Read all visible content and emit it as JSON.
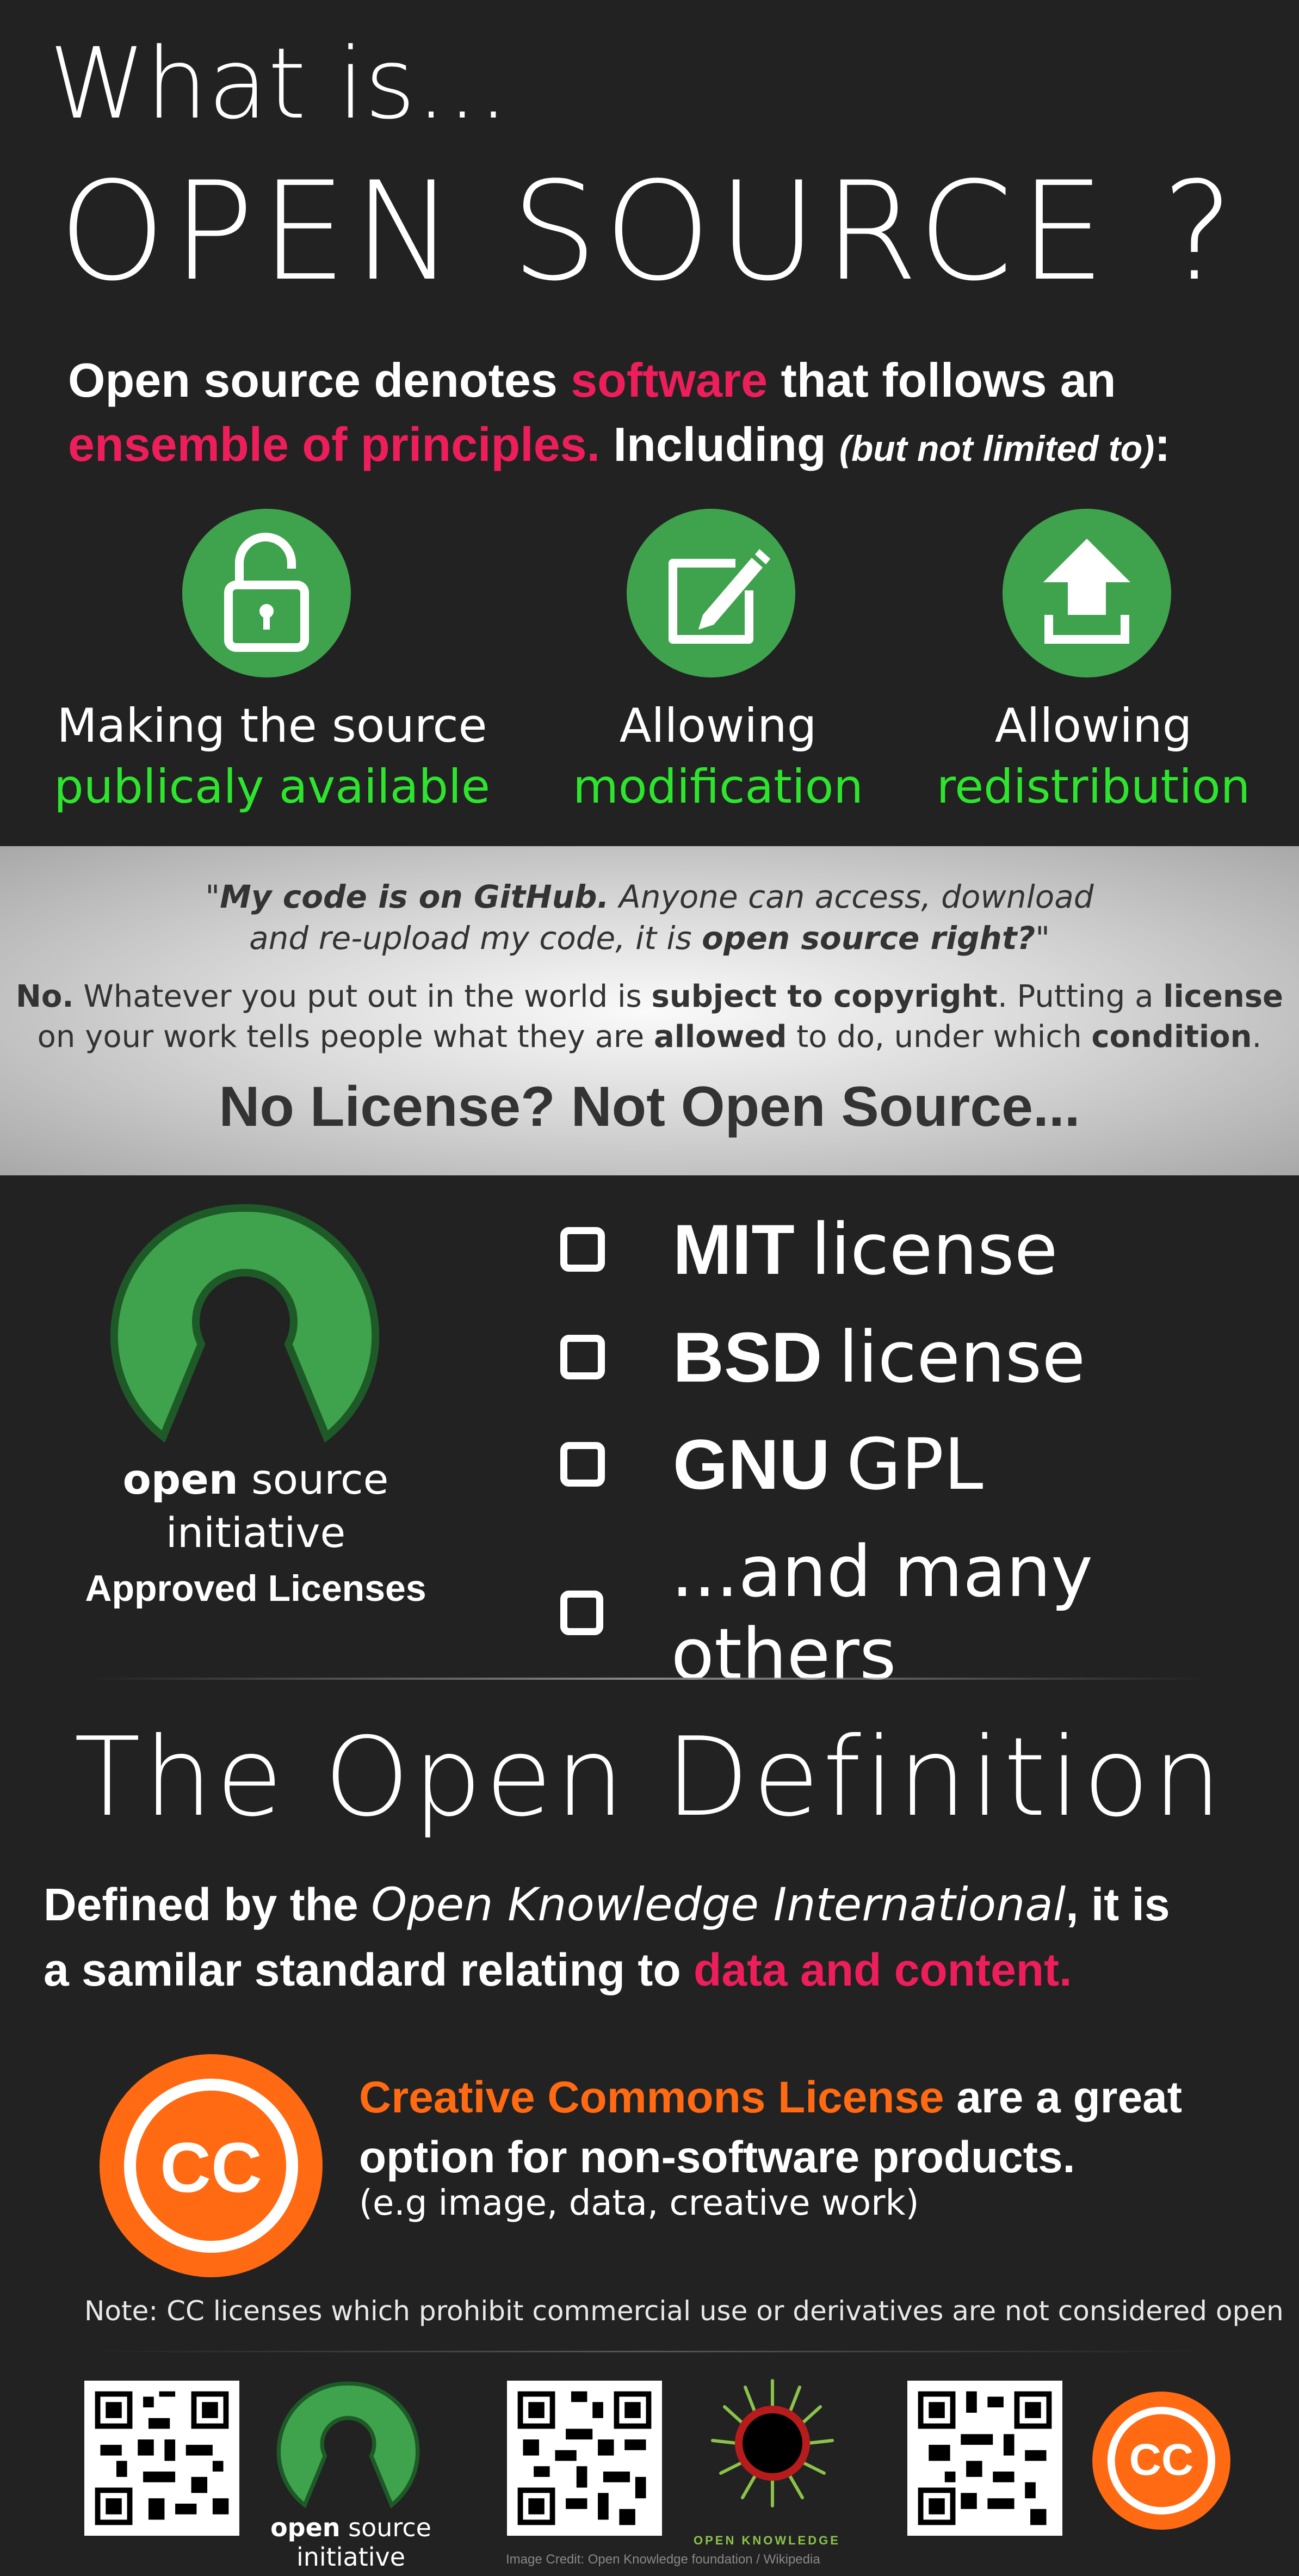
{
  "header": {
    "what_is": "What is...",
    "title": "OPEN SOURCE ?"
  },
  "intro": {
    "t1": "Open source denotes ",
    "t2": "software",
    "t3": " that follows an",
    "t4": "ensemble of principles.",
    "t5": " Including ",
    "t6": "(but not limited to)",
    "t7": ":"
  },
  "features": [
    {
      "icon": "unlocked-padlock-icon",
      "line1": "Making the source",
      "line2": "publicaly available"
    },
    {
      "icon": "edit-pencil-icon",
      "line1": "Allowing",
      "line2": "modification"
    },
    {
      "icon": "upload-arrow-icon",
      "line1": "Allowing",
      "line2": "redistribution"
    }
  ],
  "quote": {
    "q1": "\"",
    "q2": "My code is on GitHub.",
    "q3": " Anyone can access, download",
    "q4": "and re-upload my code, it is ",
    "q5": "open source right?",
    "q6": "\""
  },
  "answer": {
    "a1": "No.",
    "a2": " Whatever you put out in the world is ",
    "a3": "subject to copyright",
    "a4": ". Putting a ",
    "a5": "license",
    "a6": "on your work tells people what they are ",
    "a7": "allowed",
    "a8": " to do, under which ",
    "a9": "condition",
    "a10": "."
  },
  "no_license": "No License? Not Open Source...",
  "osi": {
    "open": "open",
    "source": " source",
    "initiative": "initiative",
    "approved": "Approved Licenses"
  },
  "licenses": [
    {
      "bold": "MIT",
      "rest": "license"
    },
    {
      "bold": "BSD",
      "rest": "license"
    },
    {
      "bold": "GNU",
      "rest": "GPL"
    },
    {
      "bold": "",
      "rest": "...and many others"
    }
  ],
  "open_definition": {
    "title": "The Open Definition",
    "d1": "Defined by the ",
    "d2": "Open Knowledge International",
    "d3": ", it is",
    "d4": "a samilar standard relating to ",
    "d5": "data and content."
  },
  "cc": {
    "logo_text": "CC",
    "c1": "Creative Commons License",
    "c2": " are a great",
    "c3": "option for non-software products.",
    "examples": "(e.g image, data, creative work)",
    "note": "Note: CC licenses which prohibit commercial use or derivatives  are not considered open"
  },
  "footer": {
    "osi_open": "open",
    "osi_source": " source",
    "osi_initiative": "initiative",
    "ok_label": "OPEN KNOWLEDGE",
    "cc_text": "CC",
    "credit": "Image  Credit: Open Knowledge foundation / Wikipedia"
  },
  "colors": {
    "background": "#222222",
    "accent_pink": "#ee1e5a",
    "accent_green": "#2ee52e",
    "icon_green": "#3fa34d",
    "cc_orange": "#ff6a13"
  }
}
